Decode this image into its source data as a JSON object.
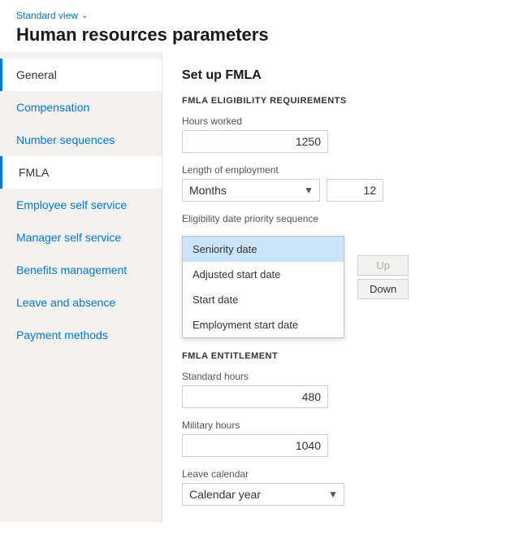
{
  "header": {
    "standard_view_label": "Standard view",
    "page_title": "Human resources parameters"
  },
  "sidebar": {
    "items": [
      {
        "id": "general",
        "label": "General",
        "active": true
      },
      {
        "id": "compensation",
        "label": "Compensation",
        "active": false
      },
      {
        "id": "number-sequences",
        "label": "Number sequences",
        "active": false
      },
      {
        "id": "fmla",
        "label": "FMLA",
        "active": false,
        "highlighted": true
      },
      {
        "id": "employee-self-service",
        "label": "Employee self service",
        "active": false
      },
      {
        "id": "manager-self-service",
        "label": "Manager self service",
        "active": false
      },
      {
        "id": "benefits-management",
        "label": "Benefits management",
        "active": false
      },
      {
        "id": "leave-and-absence",
        "label": "Leave and absence",
        "active": false
      },
      {
        "id": "payment-methods",
        "label": "Payment methods",
        "active": false
      }
    ]
  },
  "content": {
    "section_title": "Set up FMLA",
    "eligibility_section_label": "FMLA ELIGIBILITY REQUIREMENTS",
    "hours_worked_label": "Hours worked",
    "hours_worked_value": "1250",
    "length_of_employment_label": "Length of employment",
    "length_of_employment_dropdown": "Months",
    "length_of_employment_value": "12",
    "eligibility_date_label": "Eligibility date priority sequence",
    "dropdown_options": [
      {
        "id": "seniority-date",
        "label": "Seniority date",
        "selected": true
      },
      {
        "id": "adjusted-start-date",
        "label": "Adjusted start date",
        "selected": false
      },
      {
        "id": "start-date",
        "label": "Start date",
        "selected": false
      },
      {
        "id": "employment-start-date",
        "label": "Employment start date",
        "selected": false
      }
    ],
    "up_button_label": "Up",
    "down_button_label": "Down",
    "entitlement_section_label": "FMLA ENTITLEMENT",
    "standard_hours_label": "Standard hours",
    "standard_hours_value": "480",
    "military_hours_label": "Military hours",
    "military_hours_value": "1040",
    "leave_calendar_label": "Leave calendar",
    "leave_calendar_value": "Calendar year"
  }
}
